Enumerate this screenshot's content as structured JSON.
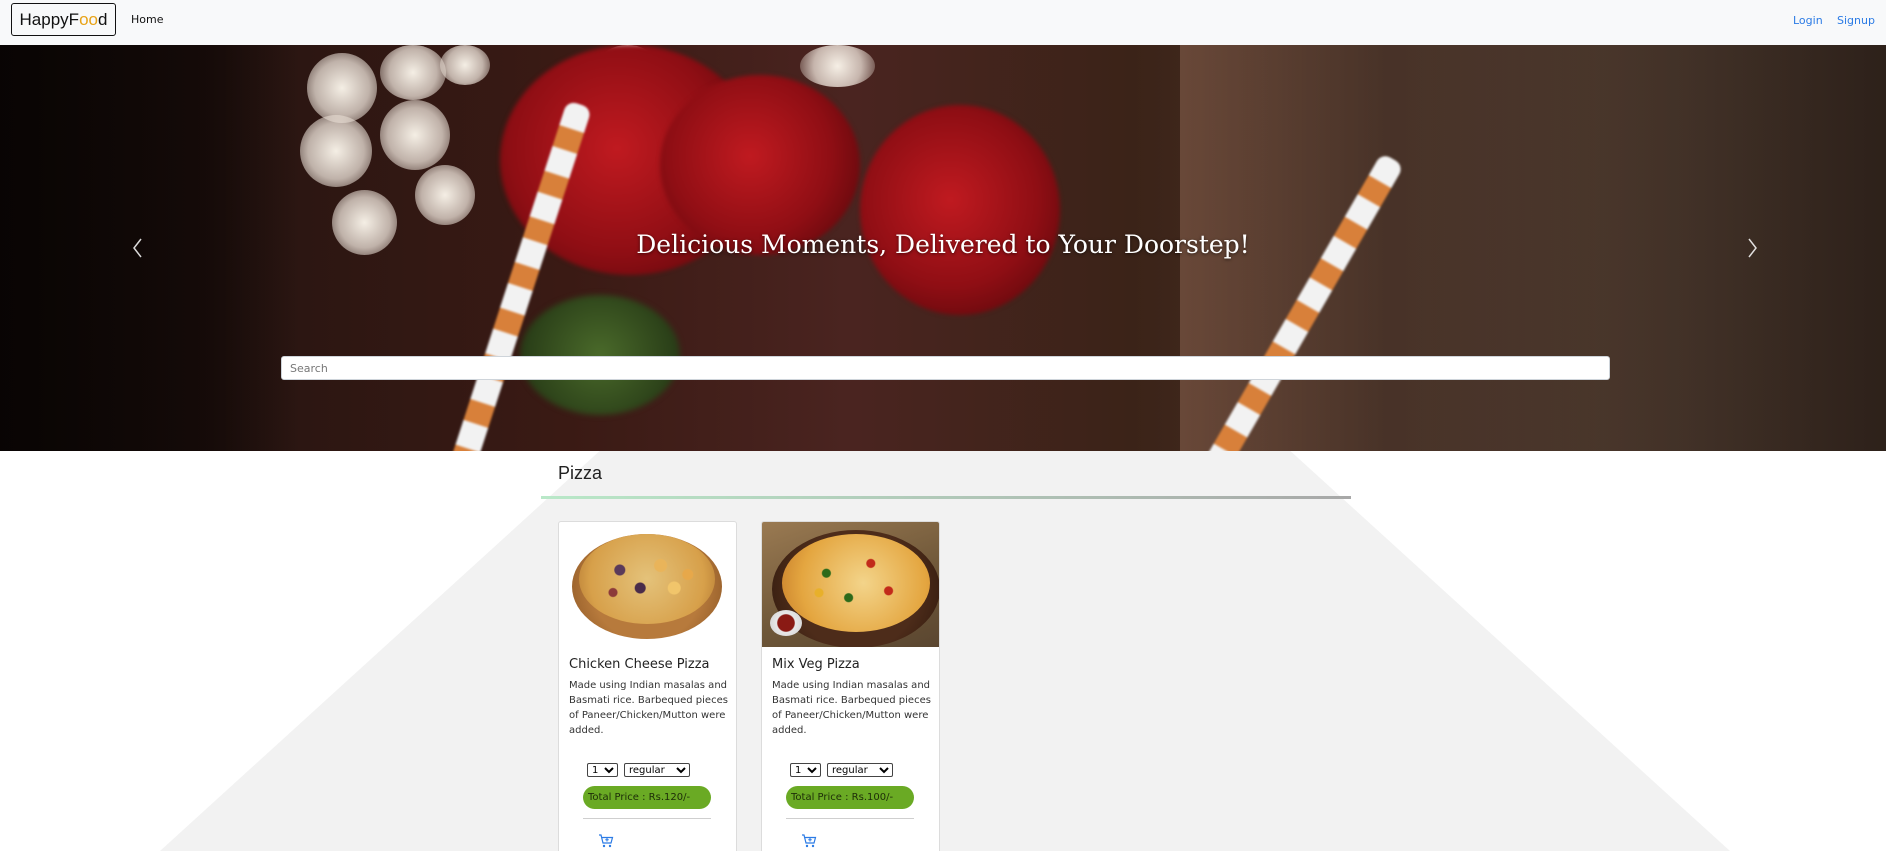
{
  "navbar": {
    "brand_pre": "HappyF",
    "brand_accent": "oo",
    "brand_post": "d",
    "home": "Home",
    "login": "Login",
    "signup": "Signup"
  },
  "hero": {
    "title": "Delicious Moments, Delivered to Your Doorstep!",
    "prev_icon": "chevron-left-icon",
    "next_icon": "chevron-right-icon"
  },
  "search": {
    "placeholder": "Search",
    "value": ""
  },
  "category": {
    "title": "Pizza"
  },
  "items": [
    {
      "name": "Chicken Cheese Pizza",
      "description": "Made using Indian masalas and Basmati rice. Barbequed pieces of Paneer/Chicken/Mutton were added.",
      "quantity": "1",
      "size": "regular",
      "price": "Total Price : Rs.120/-"
    },
    {
      "name": "Mix Veg Pizza",
      "description": "Made using Indian masalas and Basmati rice. Barbequed pieces of Paneer/Chicken/Mutton were added.",
      "quantity": "1",
      "size": "regular",
      "price": "Total Price : Rs.100/-"
    }
  ],
  "colors": {
    "brand_accent": "#e8a317",
    "link": "#2b7be5",
    "price_badge": "#6aaa24"
  }
}
